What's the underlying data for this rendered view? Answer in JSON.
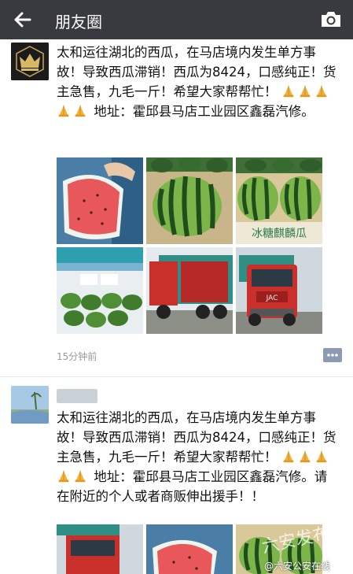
{
  "header": {
    "title": "朋友圈",
    "bg_color": "#393a3f"
  },
  "posts": [
    {
      "text": "太和运往湖北的西瓜，在马店境内发生单方事故！导致西瓜滞销！西瓜为8424，口感纯正！货主急售，九毛一斤！希望大家帮帮忙！",
      "text_tail": "  地址：霍邱县马店工业园区鑫磊汽修。",
      "emoji_count": 5,
      "emoji_icon": "praying-hands-icon",
      "photos": [
        {
          "kind": "watermelon-slice"
        },
        {
          "kind": "whole-watermelon"
        },
        {
          "kind": "watermelon-box",
          "label": "冰糖麒麟瓜"
        },
        {
          "kind": "watermelons-in-boxes"
        },
        {
          "kind": "truck-side"
        },
        {
          "kind": "truck-front",
          "plate": "JAC"
        }
      ],
      "time": "15分钟前"
    },
    {
      "text": "太和运往湖北的西瓜，在马店境内发生单方事故！导致西瓜滞销！西瓜为8424，口感纯正！货主急售，九毛一斤！希望大家帮帮忙！",
      "text_tail": "  地址：霍邱县马店工业园区鑫磊汽修。请在附近的个人或者商贩伸出援手！！",
      "emoji_count": 5,
      "emoji_icon": "praying-hands-icon",
      "photos": [
        {
          "kind": "truck-front"
        },
        {
          "kind": "watermelon-slice"
        },
        {
          "kind": "watermelon-box"
        }
      ]
    }
  ],
  "watermark": {
    "logo": "六安发布",
    "text": "@六安公安在线"
  },
  "colors": {
    "watermelon_green": "#2f7d2c",
    "watermelon_flesh": "#e8585a",
    "truck_red": "#c9302c",
    "time_gray": "#999999"
  }
}
